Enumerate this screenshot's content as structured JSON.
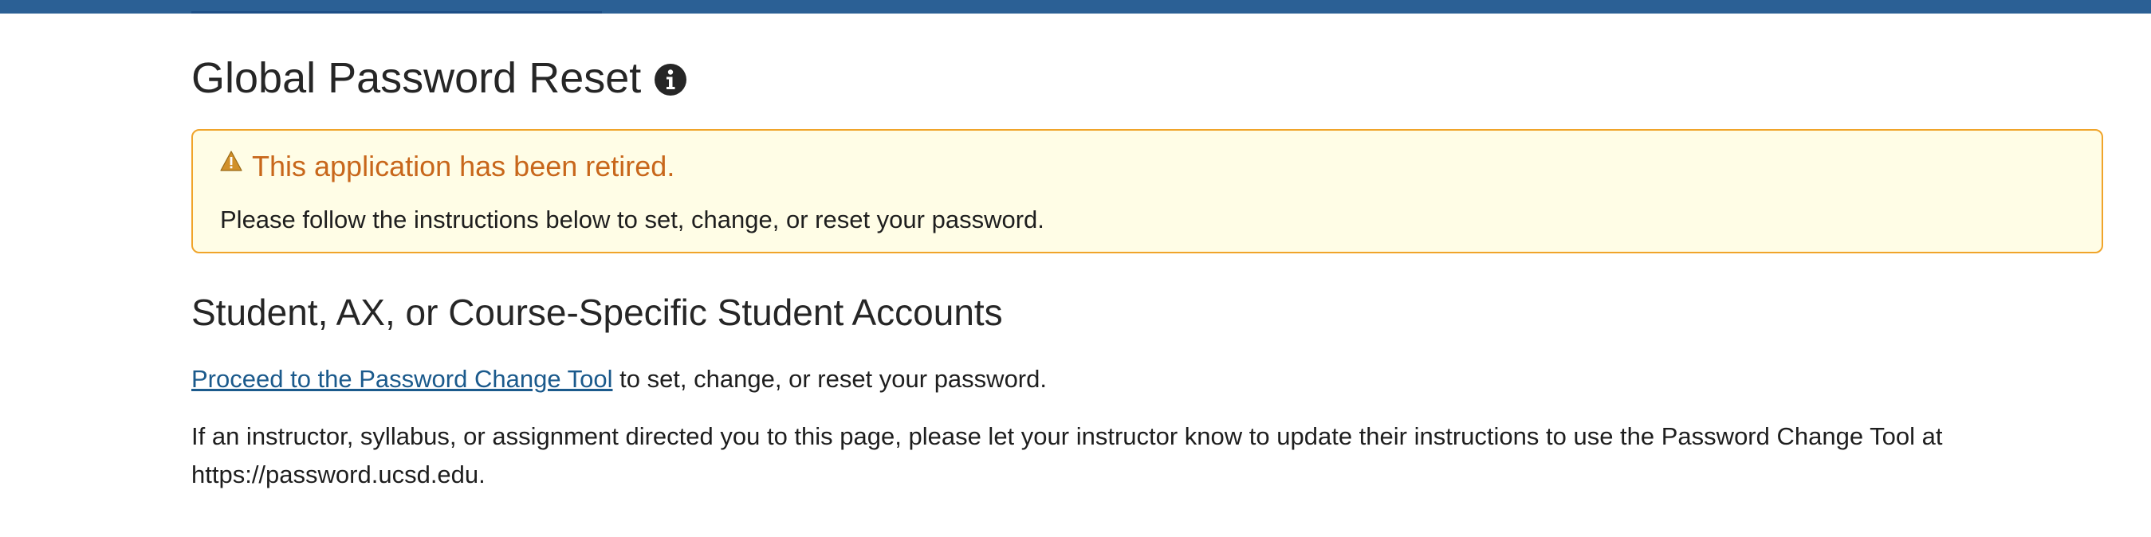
{
  "page": {
    "title": "Global Password Reset"
  },
  "alert": {
    "title": "This application has been retired.",
    "text": "Please follow the instructions below to set, change, or reset your password."
  },
  "section": {
    "heading": "Student, AX, or Course-Specific Student Accounts",
    "link_label": "Proceed to the Password Change Tool",
    "link_suffix": " to set, change, or reset your password.",
    "instructor_note": "If an instructor, syllabus, or assignment directed you to this page, please let your instructor know to update their instructions to use the Password Change Tool at https://password.ucsd.edu."
  },
  "colors": {
    "header_bar": "#2b6095",
    "alert_border": "#f0a42a",
    "alert_bg": "#fffde6",
    "alert_title": "#c8671b",
    "link": "#1b5a8c"
  },
  "icons": {
    "title_icon": "info-circle-icon",
    "alert_icon": "warning-triangle-icon"
  }
}
